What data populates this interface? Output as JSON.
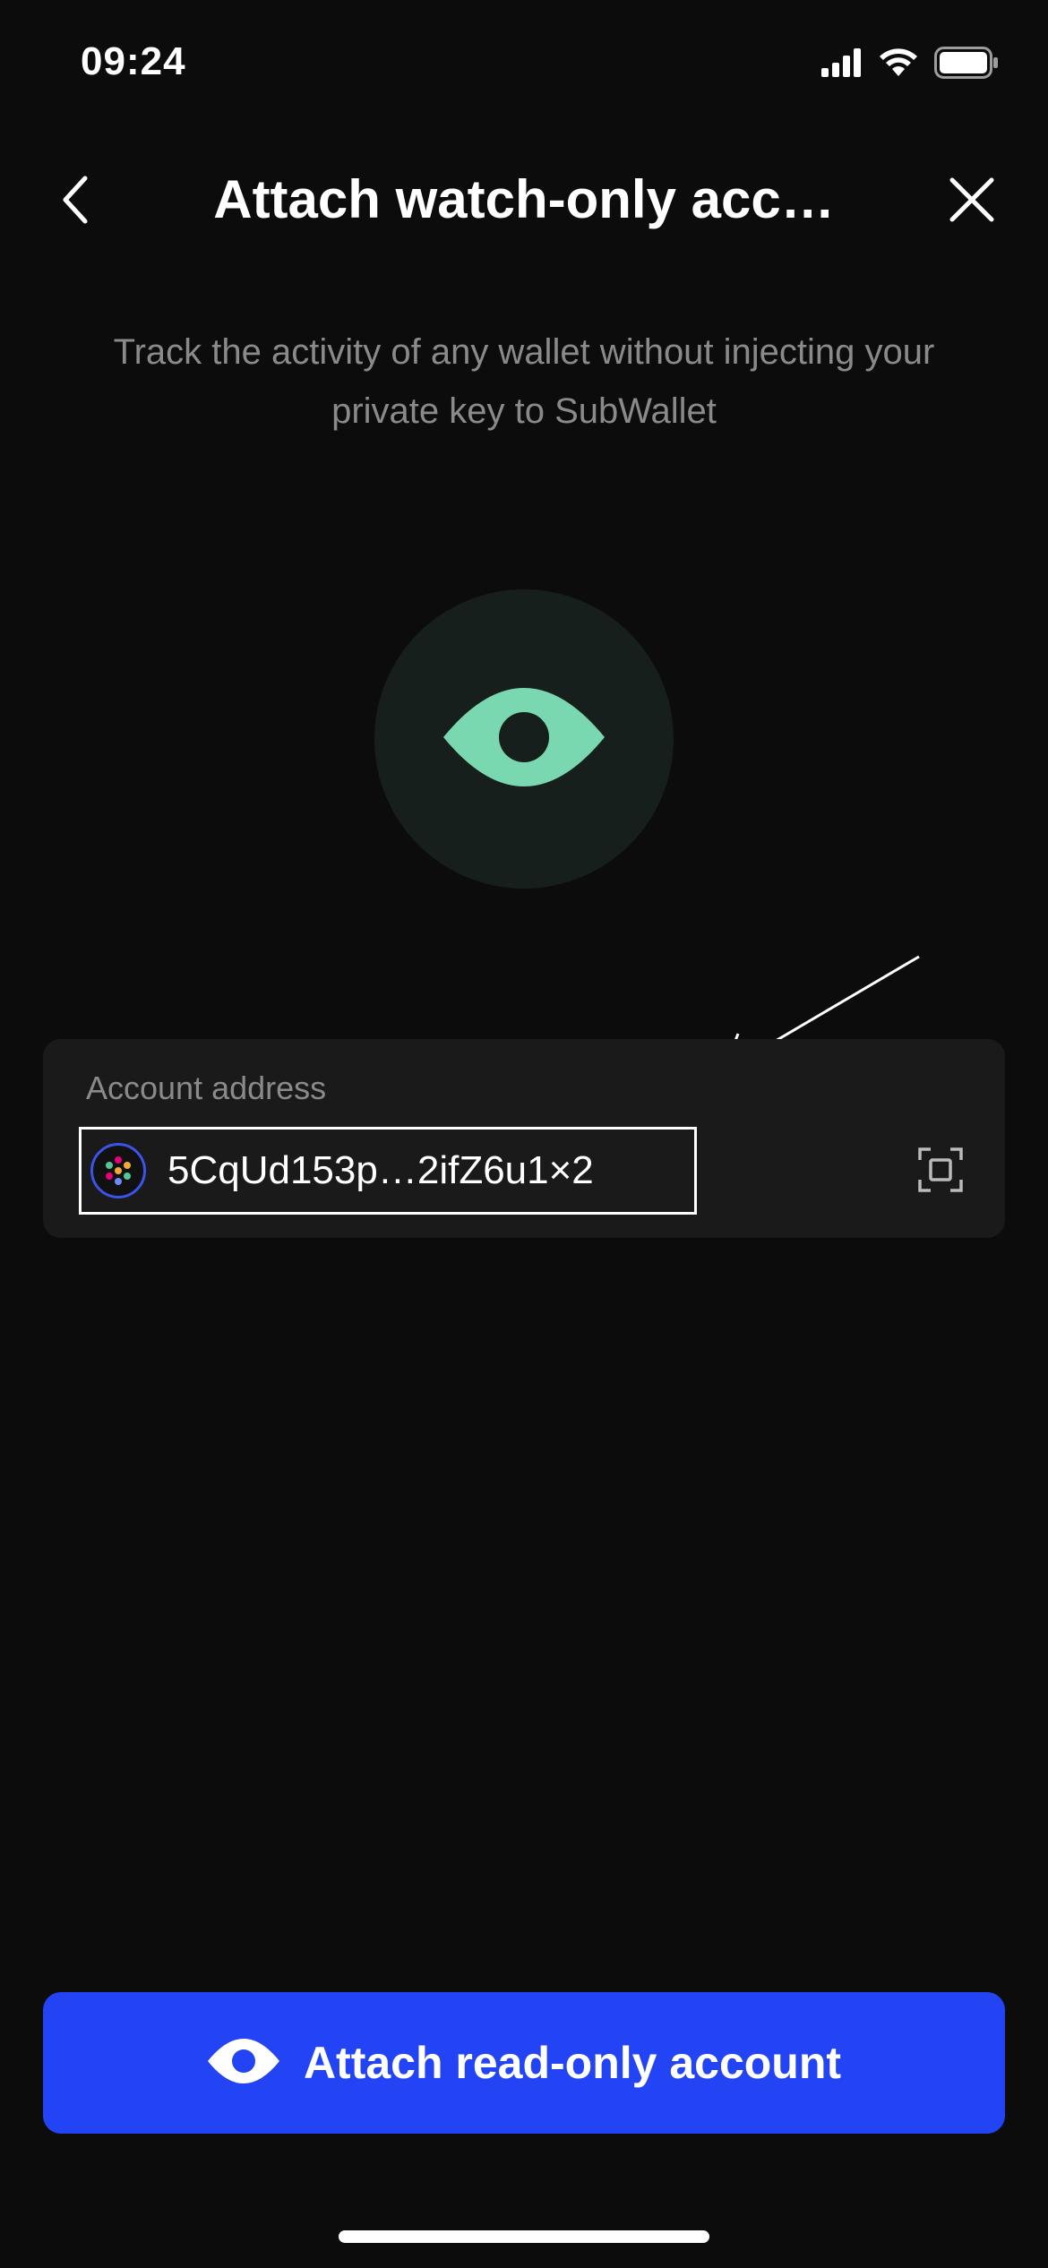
{
  "status_bar": {
    "time": "09:24",
    "icons": [
      "signal-icon",
      "wifi-icon",
      "battery-icon"
    ]
  },
  "header": {
    "title": "Attach watch-only acc…",
    "back_icon": "chevron-left-icon",
    "close_icon": "close-icon"
  },
  "subtitle": "Track the activity of any wallet without injecting your private key to SubWallet",
  "illustration": {
    "icon": "eye-icon",
    "accent_color": "#7ad8b0",
    "circle_color": "#161f1c"
  },
  "address_card": {
    "label": "Account address",
    "value": "5CqUd153p…2ifZ6u1×2",
    "avatar_icon": "polkadot-identicon-icon",
    "scan_icon": "scan-qr-icon"
  },
  "primary_button": {
    "label": "Attach read-only account",
    "icon": "eye-icon",
    "color": "#2244f5"
  },
  "colors": {
    "background": "#0c0c0c",
    "card": "#1a1a1a",
    "muted_text": "#8a8a8a"
  }
}
